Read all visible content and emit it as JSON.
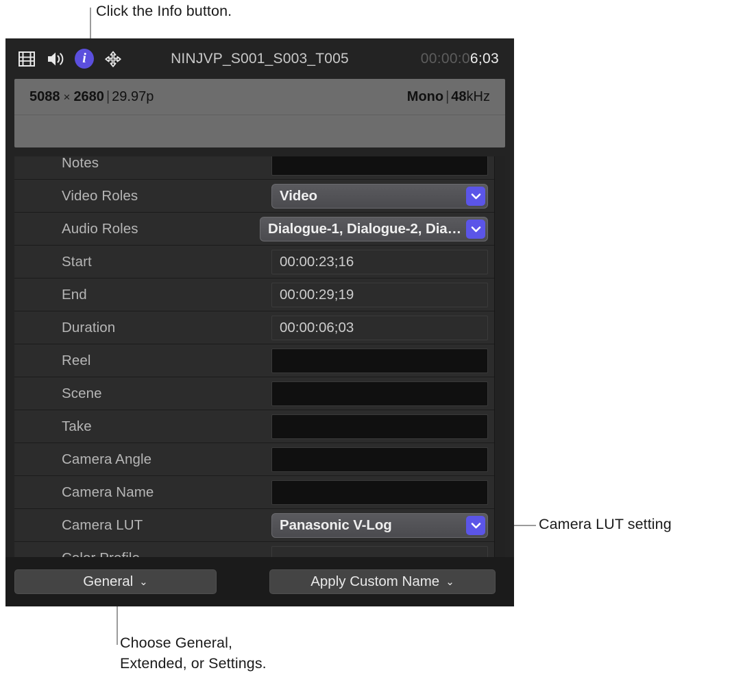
{
  "annotations": {
    "top": "Click the Info button.",
    "right": "Camera LUT setting",
    "bottom": "Choose General,\nExtended, or Settings."
  },
  "toolbar": {
    "icons": [
      {
        "name": "film-strip-icon",
        "label": "Video"
      },
      {
        "name": "speaker-icon",
        "label": "Audio"
      },
      {
        "name": "info-icon",
        "label": "i"
      },
      {
        "name": "stabilization-icon",
        "label": "Transform"
      }
    ],
    "clip_name": "NINJVP_S001_S003_T005",
    "timecode_dim": "00:00:0",
    "timecode_bright": "6;03",
    "accent_color": "#5b4fdd"
  },
  "summary": {
    "width": "5088",
    "x_sep": "×",
    "height": "2680",
    "pipe": "|",
    "frame_rate": "29.97p",
    "channels": "Mono",
    "pipe2": "|",
    "sample_rate_num": "48",
    "sample_rate_unit": "kHz"
  },
  "metadata_rows": [
    {
      "label": "Notes",
      "type": "text",
      "value": ""
    },
    {
      "label": "Video Roles",
      "type": "popup",
      "value": "Video"
    },
    {
      "label": "Audio Roles",
      "type": "popup",
      "value": "Dialogue-1, Dialogue-2, Dia…"
    },
    {
      "label": "Start",
      "type": "tc",
      "value": "00:00:23;16"
    },
    {
      "label": "End",
      "type": "tc",
      "value": "00:00:29;19"
    },
    {
      "label": "Duration",
      "type": "tc",
      "value": "00:00:06;03"
    },
    {
      "label": "Reel",
      "type": "text",
      "value": ""
    },
    {
      "label": "Scene",
      "type": "text",
      "value": ""
    },
    {
      "label": "Take",
      "type": "text",
      "value": ""
    },
    {
      "label": "Camera Angle",
      "type": "text",
      "value": ""
    },
    {
      "label": "Camera Name",
      "type": "text",
      "value": ""
    },
    {
      "label": "Camera LUT",
      "type": "popup",
      "value": "Panasonic V-Log"
    },
    {
      "label": "Color Profile",
      "type": "ro",
      "value": ""
    }
  ],
  "buttons": {
    "metadata_view": "General",
    "metadata_view_chevron": "⌄",
    "apply_name": "Apply Custom Name",
    "apply_name_chevron": "⌄"
  },
  "colors": {
    "popup_arrow": "#5b55e8",
    "window_bg": "#232323",
    "row_bg": "#2c2c2c",
    "summary_bg": "#6d6d6d"
  }
}
